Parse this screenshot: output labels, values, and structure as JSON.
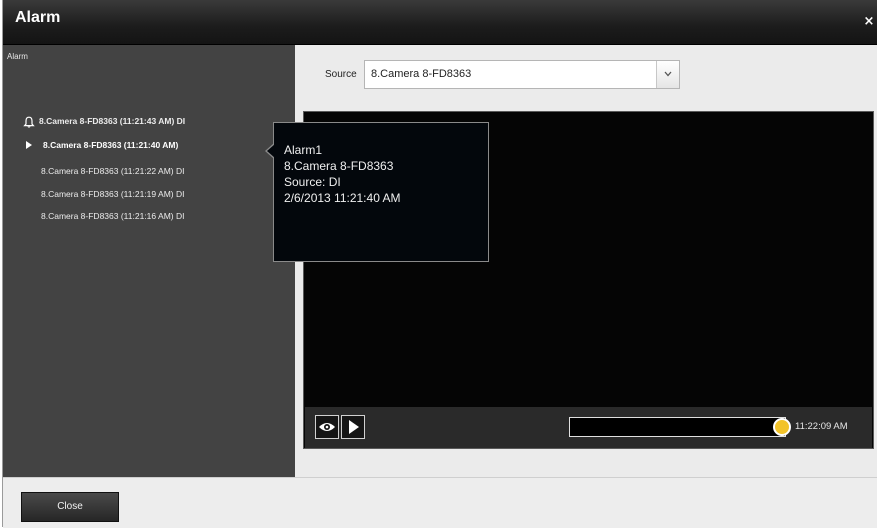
{
  "window": {
    "title": "Alarm",
    "close_glyph": "×"
  },
  "left_panel": {
    "header": "Alarm",
    "items": [
      {
        "label": "8.Camera 8-FD8363 (11:21:43 AM) DI",
        "icon": "bell-icon"
      },
      {
        "label": "8.Camera 8-FD8363 (11:21:40 AM)",
        "icon": "play-arrow-icon",
        "selected": true
      },
      {
        "label": "8.Camera 8-FD8363 (11:21:22 AM) DI"
      },
      {
        "label": "8.Camera 8-FD8363 (11:21:19 AM) DI"
      },
      {
        "label": "8.Camera 8-FD8363 (11:21:16 AM) DI"
      }
    ]
  },
  "source": {
    "label": "Source",
    "value": "8.Camera 8-FD8363"
  },
  "tooltip": {
    "lines": [
      "Alarm1",
      "8.Camera 8-FD8363",
      "Source: DI",
      "2/6/2013 11:21:40 AM"
    ]
  },
  "player": {
    "eye_icon": "eye-icon",
    "play_icon": "play-icon",
    "timeline_time": "11:22:09 AM",
    "timeline_position": 1.0
  },
  "footer": {
    "close_label": "Close"
  },
  "colors": {
    "title_bar": "#1c1c1c",
    "left_panel": "#434343",
    "selected_text": "#ffffff",
    "timeline_handle": "#f2c32a"
  }
}
